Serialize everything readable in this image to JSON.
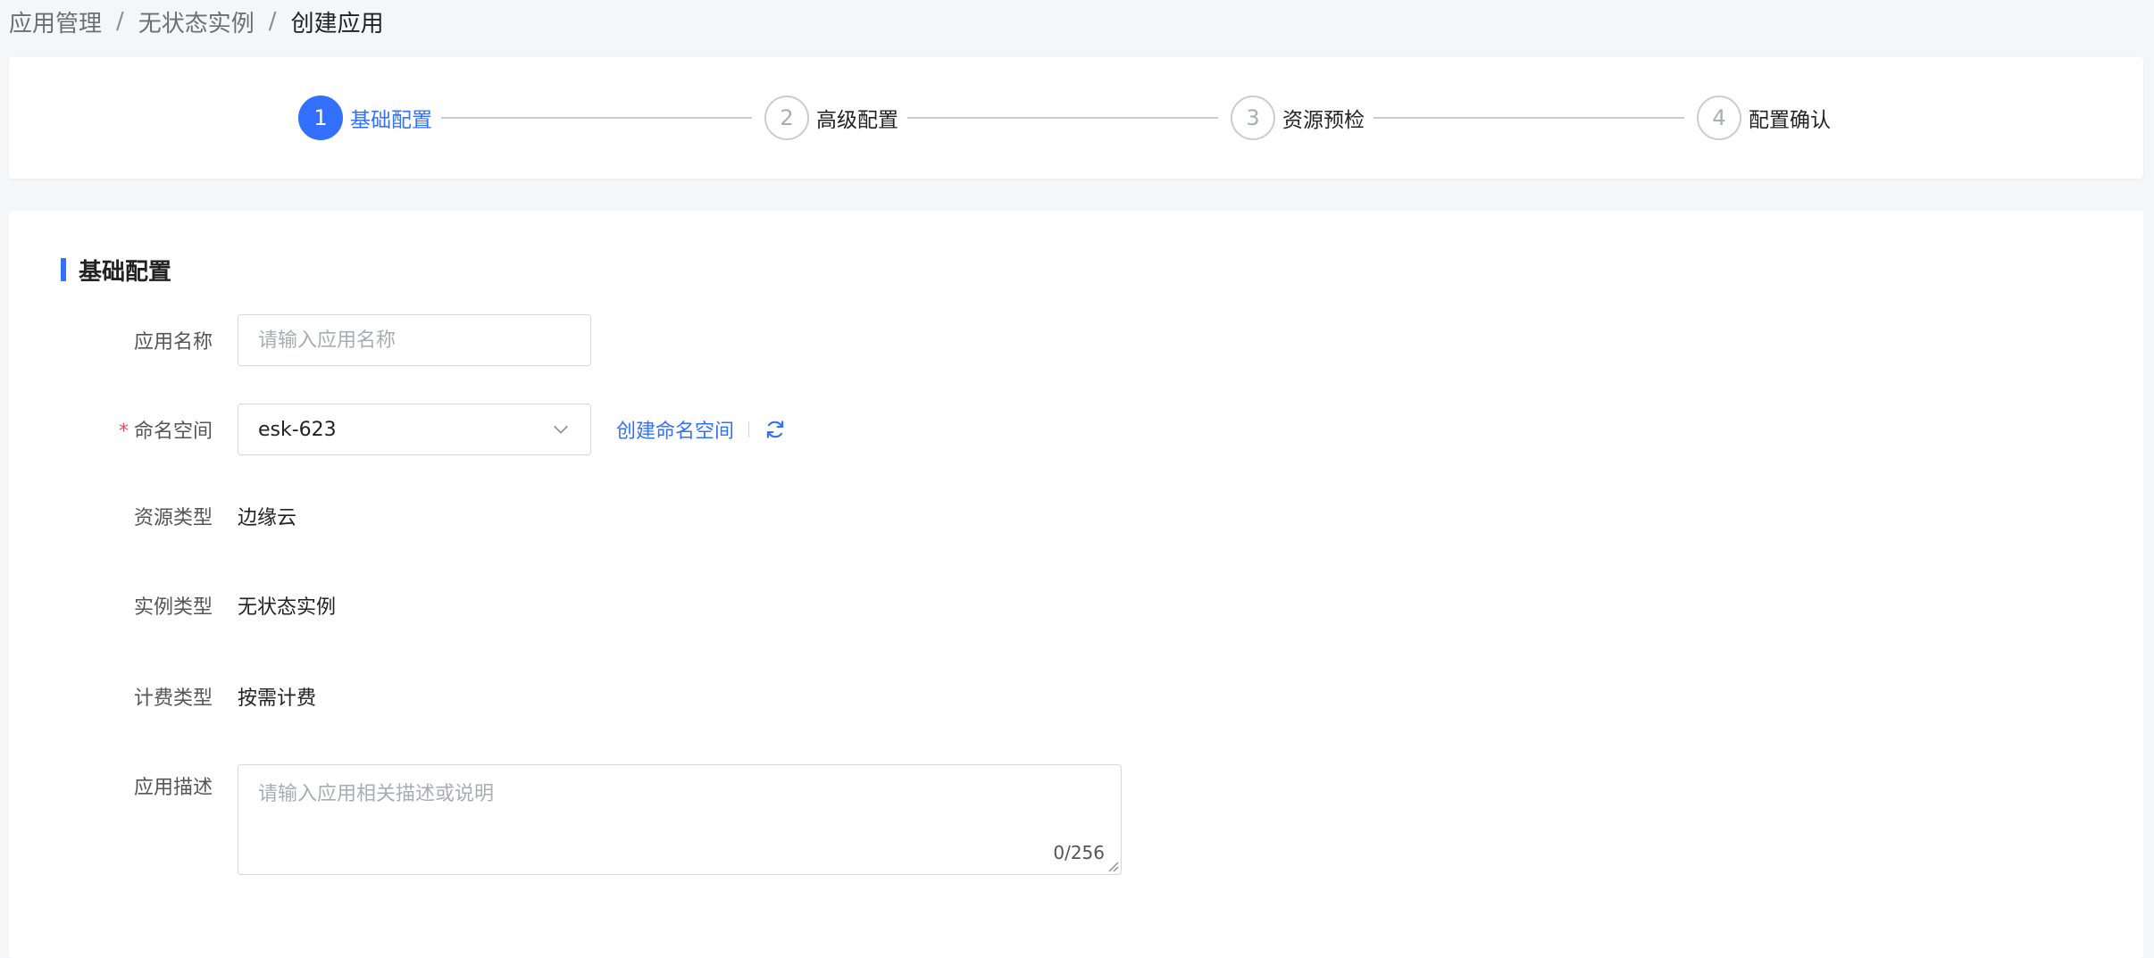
{
  "breadcrumb": {
    "items": [
      "应用管理",
      "无状态实例"
    ],
    "current": "创建应用",
    "separator": "/"
  },
  "steps": [
    {
      "number": "1",
      "label": "基础配置",
      "active": true
    },
    {
      "number": "2",
      "label": "高级配置",
      "active": false
    },
    {
      "number": "3",
      "label": "资源预检",
      "active": false
    },
    {
      "number": "4",
      "label": "配置确认",
      "active": false
    }
  ],
  "section": {
    "title": "基础配置"
  },
  "form": {
    "app_name": {
      "label": "应用名称",
      "placeholder": "请输入应用名称",
      "value": ""
    },
    "namespace": {
      "label": "命名空间",
      "required_mark": "*",
      "value": "esk-623",
      "create_link": "创建命名空间"
    },
    "resource_type": {
      "label": "资源类型",
      "value": "边缘云"
    },
    "instance_type": {
      "label": "实例类型",
      "value": "无状态实例"
    },
    "billing_type": {
      "label": "计费类型",
      "value": "按需计费"
    },
    "description": {
      "label": "应用描述",
      "placeholder": "请输入应用相关描述或说明",
      "value": "",
      "counter": "0/256"
    }
  },
  "colors": {
    "accent": "#3370ff",
    "required": "#e34d59",
    "border": "#d4d7dc"
  }
}
